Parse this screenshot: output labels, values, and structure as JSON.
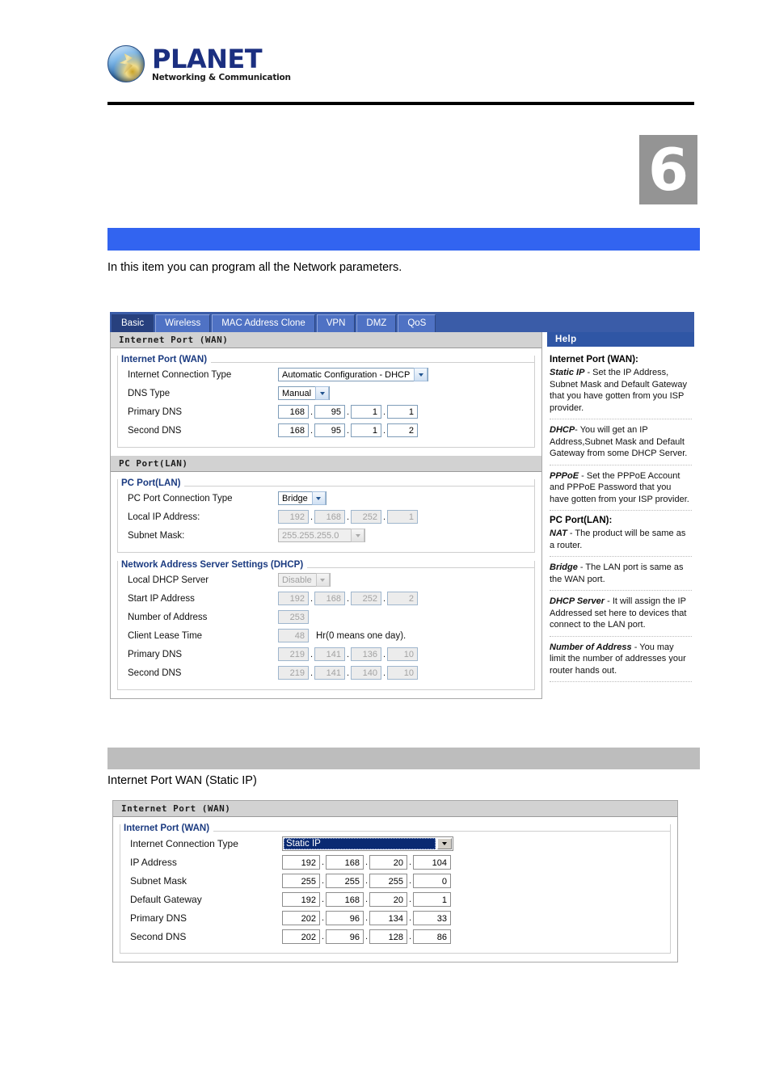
{
  "header": {
    "logo_word": "PLANET",
    "logo_tagline": "Networking & Communication",
    "chapter_number": "6"
  },
  "intro": {
    "paragraph": "In this item you can program all the Network parameters.",
    "sub_caption": "Internet Port WAN (Static IP)"
  },
  "router_ui": {
    "tabs": [
      {
        "label": "Basic",
        "active": true
      },
      {
        "label": "Wireless",
        "active": false
      },
      {
        "label": "MAC Address Clone",
        "active": false
      },
      {
        "label": "VPN",
        "active": false
      },
      {
        "label": "DMZ",
        "active": false
      },
      {
        "label": "QoS",
        "active": false
      }
    ],
    "wan_section": {
      "header": "Internet Port (WAN)",
      "legend": "Internet Port (WAN)",
      "rows": {
        "connection_type_label": "Internet Connection Type",
        "connection_type_value": "Automatic Configuration - DHCP",
        "dns_type_label": "DNS Type",
        "dns_type_value": "Manual",
        "primary_dns_label": "Primary DNS",
        "primary_dns": [
          "168",
          "95",
          "1",
          "1"
        ],
        "second_dns_label": "Second DNS",
        "second_dns": [
          "168",
          "95",
          "1",
          "2"
        ]
      }
    },
    "lan_section": {
      "header": "PC Port(LAN)",
      "legend": "PC Port(LAN)",
      "rows": {
        "connection_type_label": "PC Port Connection Type",
        "connection_type_value": "Bridge",
        "local_ip_label": "Local IP Address:",
        "local_ip": [
          "192",
          "168",
          "252",
          "1"
        ],
        "subnet_mask_label": "Subnet Mask:",
        "subnet_mask_value": "255.255.255.0"
      }
    },
    "dhcp_section": {
      "legend": "Network Address Server Settings (DHCP)",
      "rows": {
        "local_dhcp_label": "Local DHCP Server",
        "local_dhcp_value": "Disable",
        "start_ip_label": "Start IP Address",
        "start_ip": [
          "192",
          "168",
          "252",
          "2"
        ],
        "number_of_address_label": "Number of Address",
        "number_of_address_value": "253",
        "client_lease_label": "Client Lease Time",
        "client_lease_value": "48",
        "client_lease_note": "Hr(0 means one day).",
        "primary_dns_label": "Primary DNS",
        "primary_dns": [
          "219",
          "141",
          "136",
          "10"
        ],
        "second_dns_label": "Second DNS",
        "second_dns": [
          "219",
          "141",
          "140",
          "10"
        ]
      }
    },
    "help": {
      "title": "Help",
      "wan_heading": "Internet Port (WAN):",
      "static_ip_term": "Static IP",
      "static_ip_text": " - Set the IP Address, Subnet Mask and Default Gateway that you have gotten from you ISP provider.",
      "dhcp_term": "DHCP",
      "dhcp_text": "- You will get an IP Address,Subnet Mask and Default Gateway from some DHCP Server.",
      "pppoe_term": "PPPoE",
      "pppoe_text": " - Set the PPPoE Account and PPPoE Password that you have gotten from your ISP provider.",
      "lan_heading": "PC Port(LAN):",
      "nat_term": "NAT",
      "nat_text": " - The product will be same as a router.",
      "bridge_term": "Bridge",
      "bridge_text": " - The LAN port is same as the WAN port.",
      "dhcp_server_term": "DHCP Server",
      "dhcp_server_text": " - It will assign the IP Addressed set here to devices that connect to the LAN port.",
      "number_address_term": "Number of Address",
      "number_address_text": " - You may limit the number of addresses your router hands out."
    }
  },
  "static_ip_ui": {
    "header": "Internet Port (WAN)",
    "legend": "Internet Port (WAN)",
    "rows": {
      "connection_type_label": "Internet Connection Type",
      "connection_type_value": "Static IP",
      "ip_address_label": "IP Address",
      "ip_address": [
        "192",
        "168",
        "20",
        "104"
      ],
      "subnet_mask_label": "Subnet Mask",
      "subnet_mask": [
        "255",
        "255",
        "255",
        "0"
      ],
      "default_gateway_label": "Default Gateway",
      "default_gateway": [
        "192",
        "168",
        "20",
        "1"
      ],
      "primary_dns_label": "Primary DNS",
      "primary_dns": [
        "202",
        "96",
        "134",
        "33"
      ],
      "second_dns_label": "Second DNS",
      "second_dns": [
        "202",
        "96",
        "128",
        "86"
      ]
    }
  },
  "colors": {
    "banner_blue": "#3264f0",
    "banner_gray": "#bdbdbd",
    "tab_active": "#27407e",
    "tab_inactive": "#4f72c4",
    "help_title_bg": "#2f56a5",
    "chapter_bg": "#949494"
  }
}
